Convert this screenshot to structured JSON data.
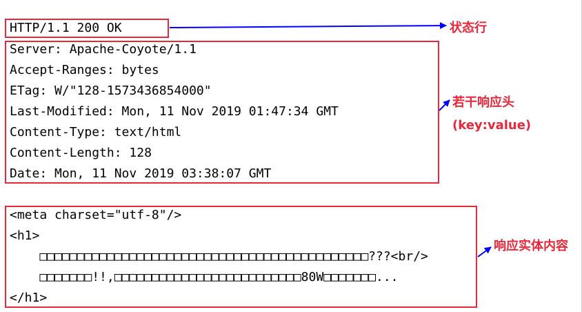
{
  "status_line": {
    "text": "HTTP/1.1 200 OK",
    "label": "状态行"
  },
  "headers": {
    "lines": [
      "Server: Apache-Coyote/1.1",
      "Accept-Ranges: bytes",
      "ETag: W/\"128-1573436854000\"",
      "Last-Modified: Mon, 11 Nov 2019 01:47:34 GMT",
      "Content-Type: text/html",
      "Content-Length: 128",
      "Date: Mon, 11 Nov 2019 03:38:07 GMT"
    ],
    "label": "若干响应头",
    "label_sub": "(key:value)"
  },
  "body": {
    "lines": [
      "<meta charset=\"utf-8\"/>",
      "<h1>",
      "    □□□□□□□□□□□□□□□□□□□□□□□□□□□□□□□□□□□□□□□□□□□□???<br/>",
      "    □□□□□□□!!,□□□□□□□□□□□□□□□□□□□□□□□□□80W□□□□□□□...",
      "</h1>"
    ],
    "label": "响应实体内容"
  },
  "colors": {
    "box_border": "#e8283a",
    "label": "#e8283a",
    "arrow": "#0000ff",
    "text": "#000000"
  }
}
